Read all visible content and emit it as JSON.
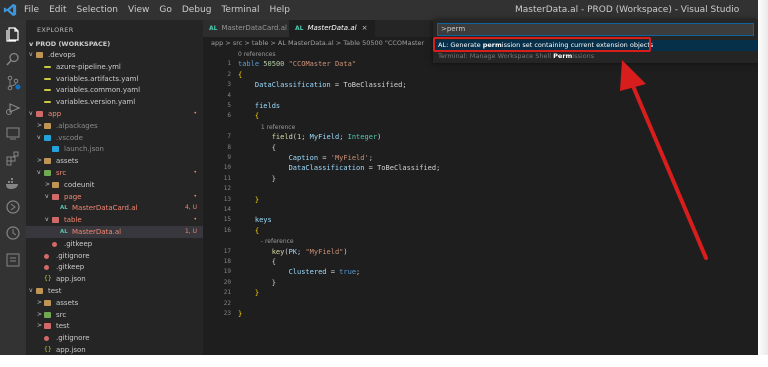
{
  "window": {
    "title": "MasterData.al - PROD (Workspace) - Visual Studio Code",
    "menu": [
      "File",
      "Edit",
      "Selection",
      "View",
      "Go",
      "Debug",
      "Terminal",
      "Help"
    ]
  },
  "activity_icons": [
    "explorer-icon",
    "search-icon",
    "source-control-icon",
    "debug-icon",
    "remote-explorer-icon",
    "extensions-icon",
    "docker-icon",
    "al-object-icon",
    "timeline-icon",
    "output-icon"
  ],
  "sidebar": {
    "title": "EXPLORER",
    "workspace": "PROD (WORKSPACE)",
    "items": [
      {
        "label": ".devops",
        "depth": 1,
        "kind": "folder",
        "chevron": "v",
        "color": "norm"
      },
      {
        "label": "azure-pipeline.yml",
        "depth": 2,
        "kind": "yaml",
        "color": "norm"
      },
      {
        "label": "variables.artifacts.yaml",
        "depth": 2,
        "kind": "yaml",
        "color": "norm"
      },
      {
        "label": "variables.common.yaml",
        "depth": 2,
        "kind": "yaml",
        "color": "norm"
      },
      {
        "label": "variables.version.yaml",
        "depth": 2,
        "kind": "yaml",
        "color": "norm"
      },
      {
        "label": "app",
        "depth": 1,
        "kind": "folder-red",
        "chevron": "v",
        "color": "red",
        "badge": "•"
      },
      {
        "label": ".alpackages",
        "depth": 2,
        "kind": "folder",
        "chevron": ">",
        "color": "muted"
      },
      {
        "label": ".vscode",
        "depth": 2,
        "kind": "vs",
        "chevron": "v",
        "color": "muted"
      },
      {
        "label": "launch.json",
        "depth": 3,
        "kind": "vs",
        "color": "muted"
      },
      {
        "label": "assets",
        "depth": 2,
        "kind": "folder",
        "chevron": ">",
        "color": "norm"
      },
      {
        "label": "src",
        "depth": 2,
        "kind": "folder-grn",
        "chevron": "v",
        "color": "red",
        "badge": "•"
      },
      {
        "label": "codeunit",
        "depth": 3,
        "kind": "folder",
        "chevron": ">",
        "color": "norm"
      },
      {
        "label": "page",
        "depth": 3,
        "kind": "folder-red",
        "chevron": "v",
        "color": "red",
        "badge": "•"
      },
      {
        "label": "MasterDataCard.al",
        "depth": 4,
        "kind": "al",
        "color": "red",
        "badge": "4, U"
      },
      {
        "label": "table",
        "depth": 3,
        "kind": "folder-red",
        "chevron": "v",
        "color": "red",
        "badge": "•"
      },
      {
        "label": "MasterData.al",
        "depth": 4,
        "kind": "al",
        "color": "red",
        "badge": "1, U",
        "selected": true
      },
      {
        "label": ".gitkeep",
        "depth": 3,
        "kind": "dot",
        "color": "norm"
      },
      {
        "label": ".gitignore",
        "depth": 2,
        "kind": "dot",
        "color": "norm"
      },
      {
        "label": ".gitkeep",
        "depth": 2,
        "kind": "dot",
        "color": "norm"
      },
      {
        "label": "app.json",
        "depth": 2,
        "kind": "json",
        "color": "norm"
      },
      {
        "label": "test",
        "depth": 1,
        "kind": "folder",
        "chevron": "v",
        "color": "norm"
      },
      {
        "label": "assets",
        "depth": 2,
        "kind": "folder",
        "chevron": ">",
        "color": "norm"
      },
      {
        "label": "src",
        "depth": 2,
        "kind": "folder-grn",
        "chevron": ">",
        "color": "norm"
      },
      {
        "label": "test",
        "depth": 2,
        "kind": "folder-red",
        "chevron": ">",
        "color": "norm"
      },
      {
        "label": ".gitignore",
        "depth": 2,
        "kind": "dot",
        "color": "norm"
      },
      {
        "label": "app.json",
        "depth": 2,
        "kind": "json",
        "color": "norm"
      }
    ]
  },
  "tabs": [
    {
      "label": "MasterDataCard.al",
      "active": false
    },
    {
      "label": "MasterData.al",
      "active": true,
      "close": "×"
    }
  ],
  "breadcrumb": "app > src > table > AL MasterData.al > Table 50500 \"CCOMaster",
  "al_tag": "AL",
  "code": {
    "lines": [
      {
        "n": "",
        "parts": [
          [
            "cmt",
            "0 references"
          ]
        ]
      },
      {
        "n": "1",
        "parts": [
          [
            "kw",
            "table "
          ],
          [
            "nu",
            "50500 "
          ],
          [
            "st",
            "\"CCOMaster Data\""
          ]
        ]
      },
      {
        "n": "2",
        "parts": [
          [
            "br",
            "{"
          ]
        ]
      },
      {
        "n": "3",
        "parts": [
          [
            "txt",
            "    "
          ],
          [
            "id",
            "DataClassification"
          ],
          [
            "txt",
            " = ToBeClassified;"
          ]
        ]
      },
      {
        "n": "4",
        "parts": []
      },
      {
        "n": "5",
        "parts": [
          [
            "txt",
            "    "
          ],
          [
            "id",
            "fields"
          ]
        ]
      },
      {
        "n": "6",
        "parts": [
          [
            "txt",
            "    "
          ],
          [
            "br",
            "{"
          ]
        ]
      },
      {
        "n": "",
        "parts": [
          [
            "cmt",
            "            1 reference"
          ]
        ]
      },
      {
        "n": "7",
        "parts": [
          [
            "txt",
            "        "
          ],
          [
            "fn",
            "field"
          ],
          [
            "txt",
            "("
          ],
          [
            "nu",
            "1"
          ],
          [
            "txt",
            "; "
          ],
          [
            "id",
            "MyField"
          ],
          [
            "txt",
            "; "
          ],
          [
            "ty",
            "Integer"
          ],
          [
            "txt",
            ")"
          ]
        ]
      },
      {
        "n": "8",
        "parts": [
          [
            "txt",
            "        {"
          ]
        ]
      },
      {
        "n": "9",
        "parts": [
          [
            "txt",
            "            "
          ],
          [
            "id",
            "Caption"
          ],
          [
            "txt",
            " = "
          ],
          [
            "st",
            "'MyField'"
          ],
          [
            "txt",
            ";"
          ]
        ]
      },
      {
        "n": "10",
        "parts": [
          [
            "txt",
            "            "
          ],
          [
            "id",
            "DataClassification"
          ],
          [
            "txt",
            " = ToBeClassified;"
          ]
        ]
      },
      {
        "n": "11",
        "parts": [
          [
            "txt",
            "        }"
          ]
        ]
      },
      {
        "n": "12",
        "parts": []
      },
      {
        "n": "13",
        "parts": [
          [
            "txt",
            "    "
          ],
          [
            "br",
            "}"
          ]
        ]
      },
      {
        "n": "14",
        "parts": []
      },
      {
        "n": "15",
        "parts": [
          [
            "txt",
            "    "
          ],
          [
            "id",
            "keys"
          ]
        ]
      },
      {
        "n": "16",
        "parts": [
          [
            "txt",
            "    "
          ],
          [
            "br",
            "{"
          ]
        ]
      },
      {
        "n": "",
        "parts": [
          [
            "cmt",
            "            - reference"
          ]
        ]
      },
      {
        "n": "17",
        "parts": [
          [
            "txt",
            "        "
          ],
          [
            "fn",
            "key"
          ],
          [
            "txt",
            "("
          ],
          [
            "id",
            "PK"
          ],
          [
            "txt",
            "; "
          ],
          [
            "st",
            "\"MyField\""
          ],
          [
            "txt",
            ")"
          ]
        ]
      },
      {
        "n": "18",
        "parts": [
          [
            "txt",
            "        {"
          ]
        ]
      },
      {
        "n": "19",
        "parts": [
          [
            "txt",
            "            "
          ],
          [
            "id",
            "Clustered"
          ],
          [
            "txt",
            " = "
          ],
          [
            "kw",
            "true"
          ],
          [
            "txt",
            ";"
          ]
        ]
      },
      {
        "n": "20",
        "parts": [
          [
            "txt",
            "        }"
          ]
        ]
      },
      {
        "n": "21",
        "parts": [
          [
            "txt",
            "    "
          ],
          [
            "br",
            "}"
          ]
        ]
      },
      {
        "n": "22",
        "parts": []
      },
      {
        "n": "23",
        "parts": [
          [
            "br",
            "}"
          ]
        ]
      }
    ]
  },
  "palette": {
    "input_value": ">perm",
    "results": [
      "AL: Generate permission set containing current extension objects",
      "Terminal: Manage Workspace Shell Permissions"
    ]
  },
  "colors": {
    "annotation_red": "#d81d1d",
    "selection_blue": "#062f4a"
  }
}
